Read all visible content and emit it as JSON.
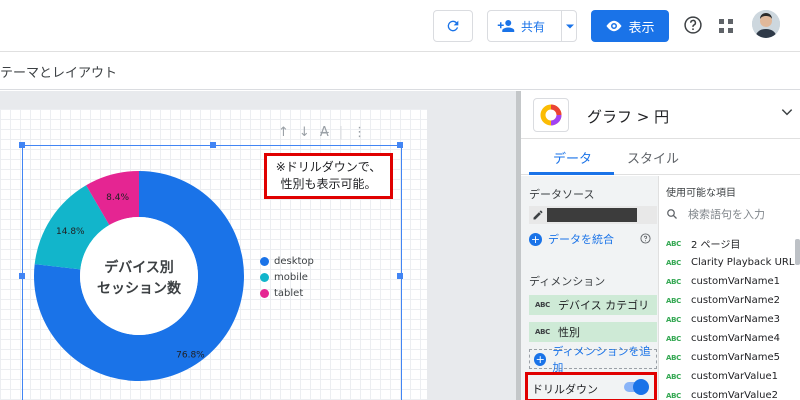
{
  "header": {
    "share_label": "共有",
    "view_label": "表示"
  },
  "subbar": {
    "theme_label": "テーマとレイアウト"
  },
  "chart": {
    "center_line1": "デバイス別",
    "center_line2": "セッション数",
    "callout_line1": "※ドリルダウンで、",
    "callout_line2": "性別も表示可能。"
  },
  "chart_data": {
    "type": "pie",
    "donut": true,
    "categories": [
      "desktop",
      "mobile",
      "tablet"
    ],
    "values": [
      76.8,
      14.8,
      8.4
    ],
    "data_labels": [
      "76.8%",
      "14.8%",
      "8.4%"
    ],
    "colors": [
      "#1a73e8",
      "#12b5cb",
      "#e52592"
    ],
    "legend_placement": "right"
  },
  "panel": {
    "title": "グラフ > 円",
    "tabs": [
      {
        "label": "データ"
      },
      {
        "label": "スタイル"
      }
    ],
    "data_source_title": "データソース",
    "merge_data_label": "データを統合",
    "dimension_title": "ディメンション",
    "dimensions": [
      {
        "type": "ABC",
        "label": "デバイス カテゴリ"
      },
      {
        "type": "ABC",
        "label": "性別"
      }
    ],
    "add_dimension_label": "ディメンションを追加",
    "drilldown_label": "ドリルダウン",
    "drilldown_on": true,
    "available_title": "使用可能な項目",
    "search_placeholder": "検索語句を入力",
    "fields": [
      {
        "type": "ABC",
        "label": "2 ページ目"
      },
      {
        "type": "ABC",
        "label": "Clarity Playback URL"
      },
      {
        "type": "ABC",
        "label": "customVarName1"
      },
      {
        "type": "ABC",
        "label": "customVarName2"
      },
      {
        "type": "ABC",
        "label": "customVarName3"
      },
      {
        "type": "ABC",
        "label": "customVarName4"
      },
      {
        "type": "ABC",
        "label": "customVarName5"
      },
      {
        "type": "ABC",
        "label": "customVarValue1"
      },
      {
        "type": "ABC",
        "label": "customVarValue2"
      }
    ]
  }
}
